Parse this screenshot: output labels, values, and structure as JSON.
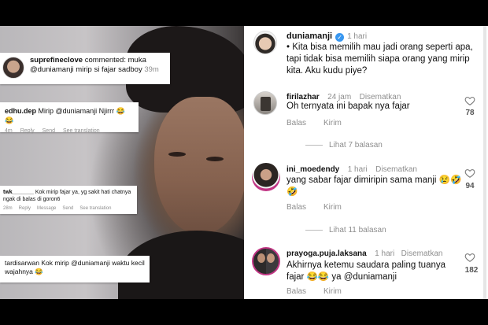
{
  "left_panel": {
    "card1": {
      "user": "suprefineclove",
      "action": "commented:",
      "text": "muka @duniamanji mirip si fajar sadboy",
      "time": "39m"
    },
    "card2": {
      "user": "edhu.dep",
      "text": "Mirip @duniamanji Njirrr 😂😂",
      "time": "4m",
      "reply": "Reply",
      "send": "Send",
      "translate": "See translation"
    },
    "card3": {
      "user": "twk_______",
      "text": "Kok mirip fajar ya, yg sakit hati chatnya ngak di balas di goron6",
      "time": "28m",
      "reply": "Reply",
      "message": "Message",
      "send": "Send",
      "translate": "See translation"
    },
    "card4": {
      "user": "tardisarwan",
      "text": "Kok mirip @duniamanji waktu kecil wajahnya 😂"
    }
  },
  "right_panel": {
    "post": {
      "user": "duniamanji",
      "time": "1 hari",
      "caption": "• Kita bisa memilih mau jadi orang seperti apa, tapi tidak bisa memilih siapa orang yang mirip kita. Aku kudu piye?"
    },
    "comments": [
      {
        "user": "firilazhar",
        "time": "24 jam",
        "pinned": "Disematkan",
        "text": "Oh ternyata ini bapak nya fajar",
        "likes": "78",
        "reply": "Balas",
        "send": "Kirim",
        "more": "Lihat 7 balasan"
      },
      {
        "user": "ini_moedendy",
        "time": "1 hari",
        "pinned": "Disematkan",
        "text": "yang sabar fajar dimiripin sama manji 😢🤣🤣",
        "likes": "94",
        "reply": "Balas",
        "send": "Kirim",
        "more": "Lihat 11 balasan"
      },
      {
        "user": "prayoga.puja.laksana",
        "time": "1 hari",
        "pinned": "Disematkan",
        "text": "Akhirnya ketemu saudara paling tuanya fajar 😂😂 ya @duniamanji",
        "likes": "182",
        "reply": "Balas",
        "send": "Kirim"
      }
    ]
  },
  "icons": {
    "heart": "heart-icon",
    "verified": "verified-badge-icon"
  },
  "colors": {
    "verified": "#3897f0",
    "muted": "#8e8e8e",
    "background": "#000000"
  }
}
